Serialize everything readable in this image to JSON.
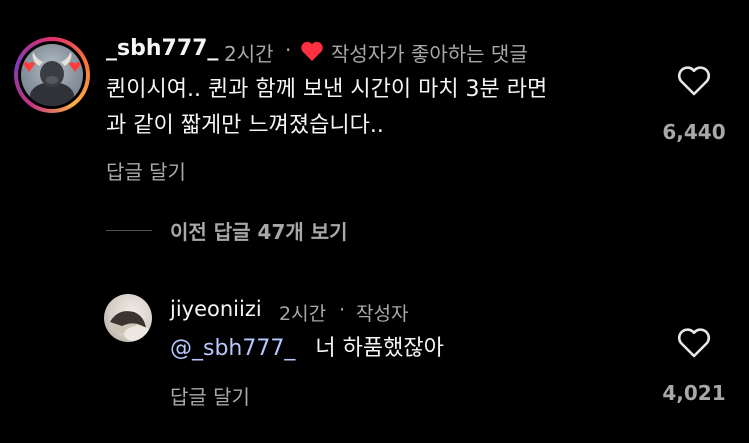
{
  "comment": {
    "username": "_sbh777_",
    "time": "2시간",
    "separator": "·",
    "liked_by_author": "작성자가 좋아하는 댓글",
    "text_line1": "퀸이시여.. 퀸과 함께 보낸 시간이 마치 3분 라면",
    "text_line2": "과 같이 짧게만 느껴졌습니다..",
    "reply_label": "답글 달기",
    "like_count": "6,440",
    "heart_color": "#ff3040"
  },
  "view_previous": {
    "label": "이전 답글 47개 보기"
  },
  "reply": {
    "username": "jiyeoniizi",
    "time": "2시간",
    "separator": "·",
    "author_badge": "작성자",
    "mention": "@_sbh777_",
    "text": "너 하품했잖아",
    "reply_label": "답글 달기",
    "like_count": "4,021"
  },
  "icons": {
    "like": "heart-outline-icon",
    "author_liked": "heart-filled-icon"
  }
}
